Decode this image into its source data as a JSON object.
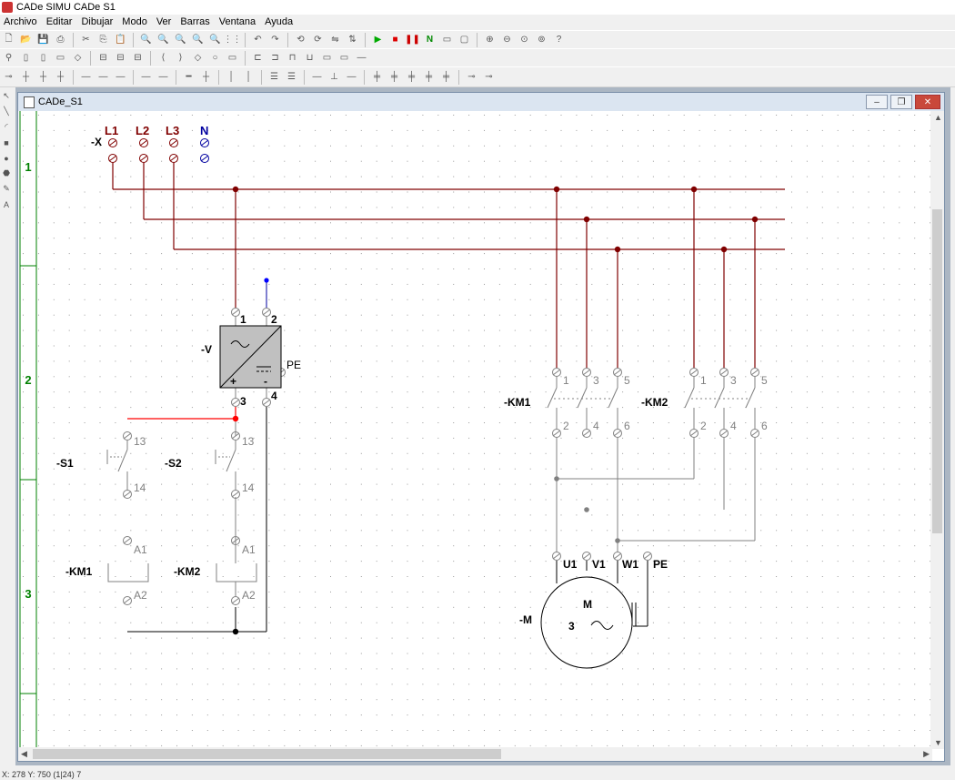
{
  "app": {
    "title": "CADe SIMU   CADe S1"
  },
  "menu": [
    "Archivo",
    "Editar",
    "Dibujar",
    "Modo",
    "Ver",
    "Barras",
    "Ventana",
    "Ayuda"
  ],
  "toolbar1_icons": [
    "new-icon",
    "open-icon",
    "save-icon",
    "print-preview-icon",
    "print-icon",
    "cut-icon",
    "copy-icon",
    "paste-icon",
    "zoom-icon",
    "zoom-icon",
    "zoom-icon",
    "zoom-icon",
    "zoom-icon",
    "grid-icon",
    "undo-icon",
    "redo-icon",
    "rotate-icon",
    "rotate-icon",
    "rotate-icon",
    "rotate-icon",
    "play-icon",
    "stop-icon",
    "pause-icon",
    "net-icon",
    "window-icon",
    "window-icon",
    "zoom-in-icon",
    "zoom-out-icon",
    "zoom-fit-icon",
    "zoom-all-icon",
    "help-icon"
  ],
  "document": {
    "title": "CADe_S1",
    "row_labels": [
      "1",
      "2",
      "3"
    ]
  },
  "schematic": {
    "terminal": {
      "ref": "-X",
      "labels": [
        "L1",
        "L2",
        "L3",
        "N"
      ]
    },
    "power_supply": {
      "ref": "-V",
      "pins": [
        "1",
        "2",
        "3",
        "4"
      ],
      "pe": "PE",
      "plus": "+",
      "minus": "-"
    },
    "s1": {
      "ref": "-S1",
      "top": "13",
      "bottom": "14"
    },
    "s2": {
      "ref": "-S2",
      "top": "13",
      "bottom": "14"
    },
    "km1_coil": {
      "ref": "-KM1",
      "top": "A1",
      "bottom": "A2"
    },
    "km2_coil": {
      "ref": "-KM2",
      "top": "A1",
      "bottom": "A2"
    },
    "km1_contacts": {
      "ref": "-KM1",
      "top": [
        "1",
        "3",
        "5"
      ],
      "bottom": [
        "2",
        "4",
        "6"
      ]
    },
    "km2_contacts": {
      "ref": "-KM2",
      "top": [
        "1",
        "3",
        "5"
      ],
      "bottom": [
        "2",
        "4",
        "6"
      ]
    },
    "motor": {
      "ref": "-M",
      "terminals": [
        "U1",
        "V1",
        "W1",
        "PE"
      ],
      "letter": "M",
      "phases": "3",
      "symbol": "~"
    }
  },
  "status": {
    "text": "X: 278  Y: 750 (1|24)  7"
  },
  "colors": {
    "bus": "#800000",
    "control": "#808080",
    "red_wire": "#ff0000",
    "terminal_label": "#800000",
    "neutral": "#0000a0",
    "row_label": "#008000"
  }
}
